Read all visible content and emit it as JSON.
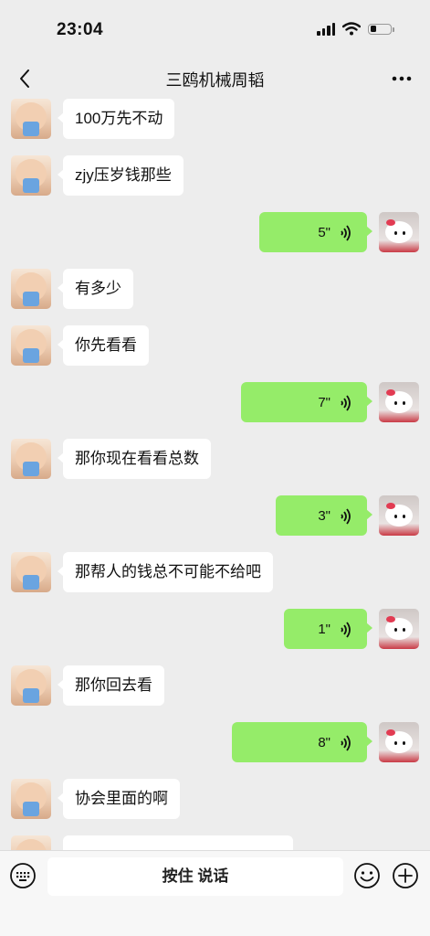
{
  "status_bar": {
    "time": "23:04"
  },
  "nav": {
    "title": "三鸥机械周韬"
  },
  "messages": [
    {
      "side": "left",
      "kind": "text",
      "text": "100万先不动"
    },
    {
      "side": "left",
      "kind": "text",
      "text": "zjy压岁钱那些"
    },
    {
      "side": "right",
      "kind": "voice",
      "duration": "5\""
    },
    {
      "side": "left",
      "kind": "text",
      "text": "有多少"
    },
    {
      "side": "left",
      "kind": "text",
      "text": "你先看看"
    },
    {
      "side": "right",
      "kind": "voice",
      "duration": "7\""
    },
    {
      "side": "left",
      "kind": "text",
      "text": "那你现在看看总数"
    },
    {
      "side": "right",
      "kind": "voice",
      "duration": "3\""
    },
    {
      "side": "left",
      "kind": "text",
      "text": "那帮人的钱总不可能不给吧"
    },
    {
      "side": "right",
      "kind": "voice",
      "duration": "1\""
    },
    {
      "side": "left",
      "kind": "text",
      "text": "那你回去看"
    },
    {
      "side": "right",
      "kind": "voice",
      "duration": "8\""
    },
    {
      "side": "left",
      "kind": "text",
      "text": "协会里面的啊"
    },
    {
      "side": "left",
      "kind": "text",
      "text": ""
    }
  ],
  "input_bar": {
    "hold_to_talk": "按住 说话"
  },
  "icons": {
    "back": "chevron-left-icon",
    "more": "more-dots-icon",
    "keyboard": "keyboard-icon",
    "emoji": "emoji-icon",
    "plus": "plus-circle-icon",
    "voice": "voice-wave-icon"
  },
  "colors": {
    "background": "#ededed",
    "sent_bubble": "#95ec69",
    "received_bubble": "#ffffff"
  }
}
